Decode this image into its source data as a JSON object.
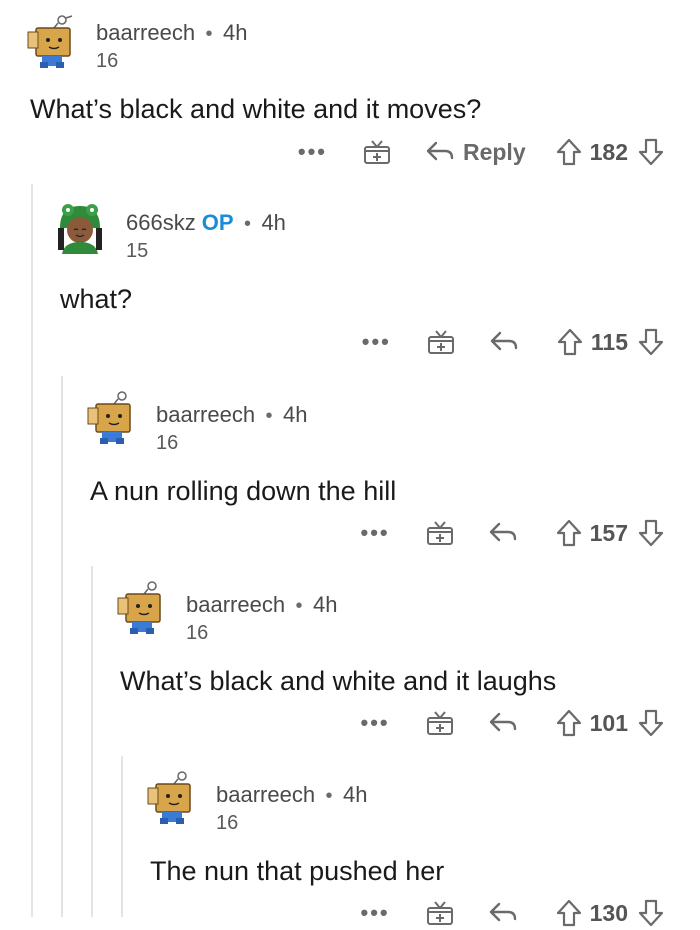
{
  "comments": [
    {
      "username": "baarreech",
      "op": "",
      "time": "4h",
      "karma": "16",
      "body": "What’s black and white and it moves?",
      "reply_label": "Reply",
      "votes": "182",
      "more": "•••"
    },
    {
      "username": "666skz",
      "op": "OP",
      "time": "4h",
      "karma": "15",
      "body": "what?",
      "reply_label": "",
      "votes": "115",
      "more": "•••"
    },
    {
      "username": "baarreech",
      "op": "",
      "time": "4h",
      "karma": "16",
      "body": "A nun rolling down the hill",
      "reply_label": "",
      "votes": "157",
      "more": "•••"
    },
    {
      "username": "baarreech",
      "op": "",
      "time": "4h",
      "karma": "16",
      "body": "What’s black and white and it laughs",
      "reply_label": "",
      "votes": "101",
      "more": "•••"
    },
    {
      "username": "baarreech",
      "op": "",
      "time": "4h",
      "karma": "16",
      "body": "The nun that pushed her",
      "reply_label": "",
      "votes": "130",
      "more": "•••"
    }
  ],
  "separator": "•",
  "colors": {
    "op": "#1a8cd8",
    "text": "#1a1a1b",
    "muted": "#6a6a6a",
    "thread_line": "#e4e4e4"
  },
  "icons": [
    "award-icon",
    "reply-arrow-icon",
    "upvote-icon",
    "downvote-icon",
    "tv-avatar-icon",
    "frog-hat-avatar-icon"
  ]
}
